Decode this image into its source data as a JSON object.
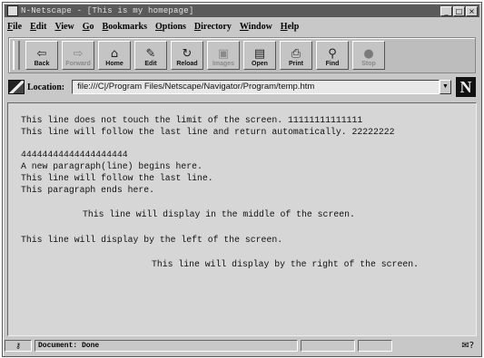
{
  "window": {
    "title": "N-Netscape - [This is my homepage]",
    "buttons": {
      "minimize": "_",
      "maximize": "□",
      "close": "×"
    }
  },
  "menu": [
    "File",
    "Edit",
    "View",
    "Go",
    "Bookmarks",
    "Options",
    "Directory",
    "Window",
    "Help"
  ],
  "toolbar": {
    "buttons": [
      {
        "label": "Back",
        "icon": "⇦",
        "enabled": true
      },
      {
        "label": "Forward",
        "icon": "⇨",
        "enabled": false
      },
      {
        "label": "Home",
        "icon": "⌂",
        "enabled": true
      },
      {
        "label": "Edit",
        "icon": "✎",
        "enabled": true
      },
      {
        "label": "Reload",
        "icon": "↻",
        "enabled": true
      },
      {
        "label": "Images",
        "icon": "▣",
        "enabled": false
      },
      {
        "label": "Open",
        "icon": "▤",
        "enabled": true
      },
      {
        "label": "Print",
        "icon": "⎙",
        "enabled": true
      },
      {
        "label": "Find",
        "icon": "⚲",
        "enabled": true
      },
      {
        "label": "Stop",
        "icon": "●",
        "enabled": false
      }
    ]
  },
  "location": {
    "label": "Location:",
    "url": "file:///C|/Program Files/Netscape/Navigator/Program/temp.htm",
    "logo": "N"
  },
  "content": {
    "lines": [
      "This line does not touch the limit of the screen. 11111111111111",
      "This line will follow the last line and return automatically. 22222222",
      "44444444444444444444",
      "A new paragraph(line) begins here.",
      "This line will follow the last line.",
      "This paragraph ends here.",
      "This line will display in the middle of the screen.",
      "This line will display by the left of the screen.",
      "This line will display by the right of the screen."
    ]
  },
  "status": {
    "security_icon": "key-icon",
    "text": "Document: Done",
    "mail_icon": "mail-icon"
  }
}
